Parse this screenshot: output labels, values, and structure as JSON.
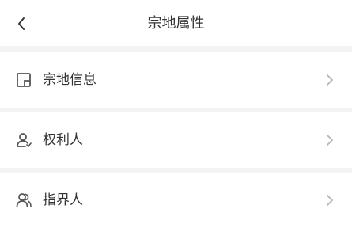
{
  "header": {
    "title": "宗地属性",
    "back_icon": "chevron-left-icon"
  },
  "menu": {
    "items": [
      {
        "label": "宗地信息",
        "icon": "parcel-info-icon"
      },
      {
        "label": "权利人",
        "icon": "owner-user-icon"
      },
      {
        "label": "指界人",
        "icon": "boundary-people-icon"
      }
    ]
  },
  "colors": {
    "background": "#f2f3f5",
    "surface": "#ffffff",
    "text": "#333333",
    "icon": "#555555",
    "chevron": "#b5b5b5"
  }
}
